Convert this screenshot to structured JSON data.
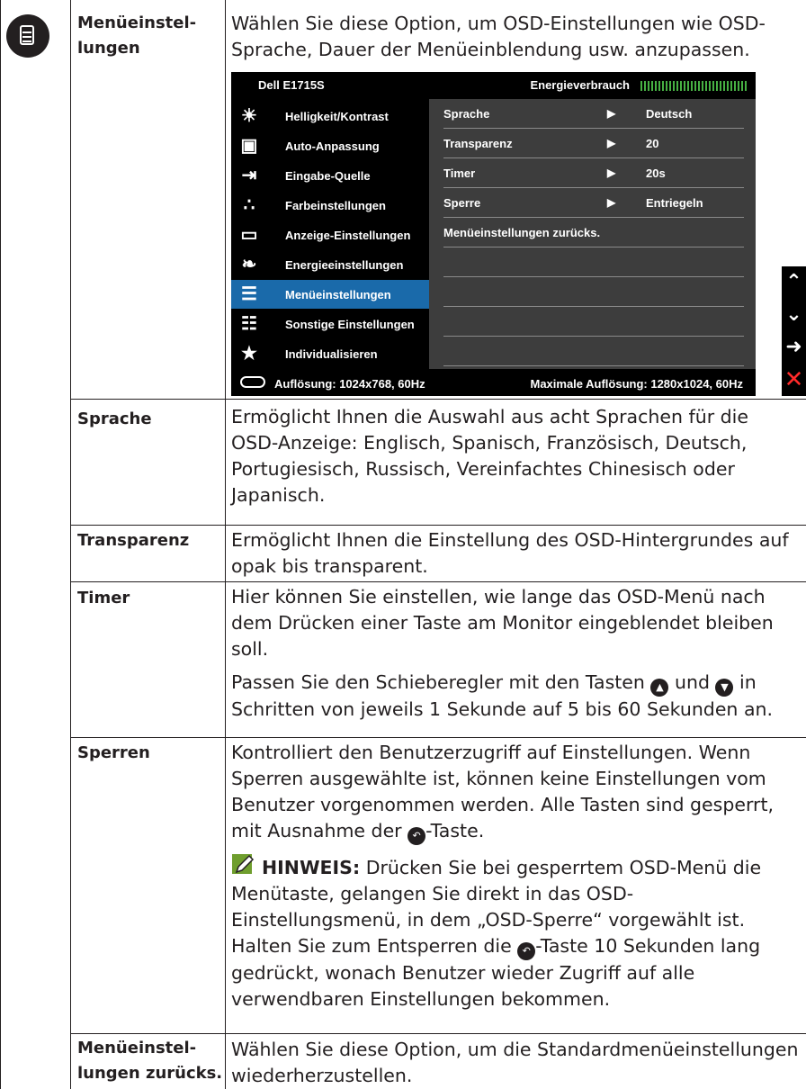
{
  "menu_icon": "menu-settings-icon",
  "sections": [
    {
      "term": [
        "Menüeinstel-",
        "lungen"
      ],
      "desc": [
        "Wählen Sie diese Option, um OSD-Einstellungen wie OSD-Sprache, Dauer der Menüeinblendung usw. anzupassen."
      ]
    },
    {
      "term": [
        "Sprache"
      ],
      "desc": [
        "Ermöglicht Ihnen die Auswahl aus acht Sprachen für die OSD-Anzeige: Englisch, Spanisch, Französisch, Deutsch, Portugiesisch, Russisch, Vereinfachtes Chinesisch oder Japanisch."
      ]
    },
    {
      "term": [
        "Transparenz"
      ],
      "desc": [
        "Ermöglicht Ihnen die Einstellung des OSD-Hintergrundes auf opak bis transparent."
      ]
    },
    {
      "term": [
        "Timer"
      ],
      "desc": [
        "Hier können Sie einstellen, wie lange das OSD-Menü nach dem Drücken einer Taste am Monitor eingeblendet bleiben soll.",
        "Passen Sie den Schieberegler mit den Tasten",
        "und",
        "in Schritten von jeweils 1 Sekunde auf 5 bis 60 Sekunden an."
      ]
    },
    {
      "term": [
        "Sperren"
      ],
      "desc": [
        "Kontrolliert den Benutzerzugriff auf Einstellungen. Wenn Sperren ausgewählte ist, können keine Einstellungen vom Benutzer vorgenommen werden. Alle Tasten sind gesperrt, mit Ausnahme der",
        "-Taste."
      ],
      "note_label": "HINWEIS:",
      "note": [
        "Drücken Sie bei gesperrtem OSD-Menü die Menütaste, gelangen Sie direkt in das OSD-Einstellungsmenü, in dem „OSD-Sperre“ vorgewählt ist. Halten Sie zum Entsperren die",
        "-Taste 10 Sekunden lang gedrückt, wonach Benutzer wieder Zugriff auf alle verwendbaren Einstellungen bekommen."
      ]
    },
    {
      "term": [
        "Menüeinstel-",
        "lungen zurücks."
      ],
      "desc": [
        "Wählen Sie diese Option, um die Standardmenüeinstellungen wiederherzustellen."
      ]
    }
  ],
  "osd": {
    "model": "Dell E1715S",
    "power_label": "Energieverbrauch",
    "menu": [
      {
        "label": "Helligkeit/Kontrast",
        "icon": "brightness-icon"
      },
      {
        "label": "Auto-Anpassung",
        "icon": "auto-adjust-icon"
      },
      {
        "label": "Eingabe-Quelle",
        "icon": "input-source-icon"
      },
      {
        "label": "Farbeinstellungen",
        "icon": "color-icon"
      },
      {
        "label": "Anzeige-Einstellungen",
        "icon": "display-icon"
      },
      {
        "label": "Energieeinstellungen",
        "icon": "energy-icon"
      },
      {
        "label": "Menüeinstellungen",
        "icon": "menu-icon",
        "active": true
      },
      {
        "label": "Sonstige Einstellungen",
        "icon": "other-settings-icon"
      },
      {
        "label": "Individualisieren",
        "icon": "star-icon"
      }
    ],
    "rows": [
      {
        "key": "Sprache",
        "value": "Deutsch"
      },
      {
        "key": "Transparenz",
        "value": "20"
      },
      {
        "key": "Timer",
        "value": "20s"
      },
      {
        "key": "Sperre",
        "value": "Entriegeln"
      },
      {
        "key": "Menüeinstellungen zurücks.",
        "value": ""
      }
    ],
    "resolution": "Auflösung: 1024x768, 60Hz",
    "max_resolution": "Maximale Auflösung: 1280x1024, 60Hz",
    "side_keys": [
      "up-icon",
      "down-icon",
      "enter-icon",
      "close-icon"
    ],
    "close_color": "#ff2a2a",
    "active_color": "#1a6aaa"
  }
}
